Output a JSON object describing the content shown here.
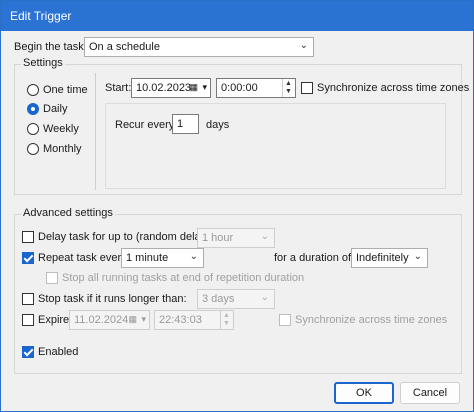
{
  "window": {
    "title": "Edit Trigger"
  },
  "begin": {
    "label": "Begin the task:",
    "value": "On a schedule"
  },
  "settings": {
    "group_title": "Settings",
    "options": [
      {
        "label": "One time",
        "selected": false
      },
      {
        "label": "Daily",
        "selected": true
      },
      {
        "label": "Weekly",
        "selected": false
      },
      {
        "label": "Monthly",
        "selected": false
      }
    ],
    "start_label": "Start:",
    "start_date": "10.02.2023",
    "start_time": "0:00:00",
    "sync_label": "Synchronize across time zones",
    "recur_label": "Recur every:",
    "recur_value": "1",
    "recur_unit": "days"
  },
  "advanced": {
    "group_title": "Advanced settings",
    "delay_label": "Delay task for up to (random delay):",
    "delay_value": "1 hour",
    "repeat_label": "Repeat task every:",
    "repeat_value": "1 minute",
    "duration_label": "for a duration of:",
    "duration_value": "Indefinitely",
    "stop_all_label": "Stop all running tasks at end of repetition duration",
    "stop_if_label": "Stop task if it runs longer than:",
    "stop_if_value": "3 days",
    "expire_label": "Expire:",
    "expire_date": "11.02.2024",
    "expire_time": "22:43:03",
    "expire_sync_label": "Synchronize across time zones",
    "enabled_label": "Enabled"
  },
  "buttons": {
    "ok": "OK",
    "cancel": "Cancel"
  },
  "colors": {
    "accent": "#1a66cc",
    "titlebar": "#2a73d3"
  }
}
